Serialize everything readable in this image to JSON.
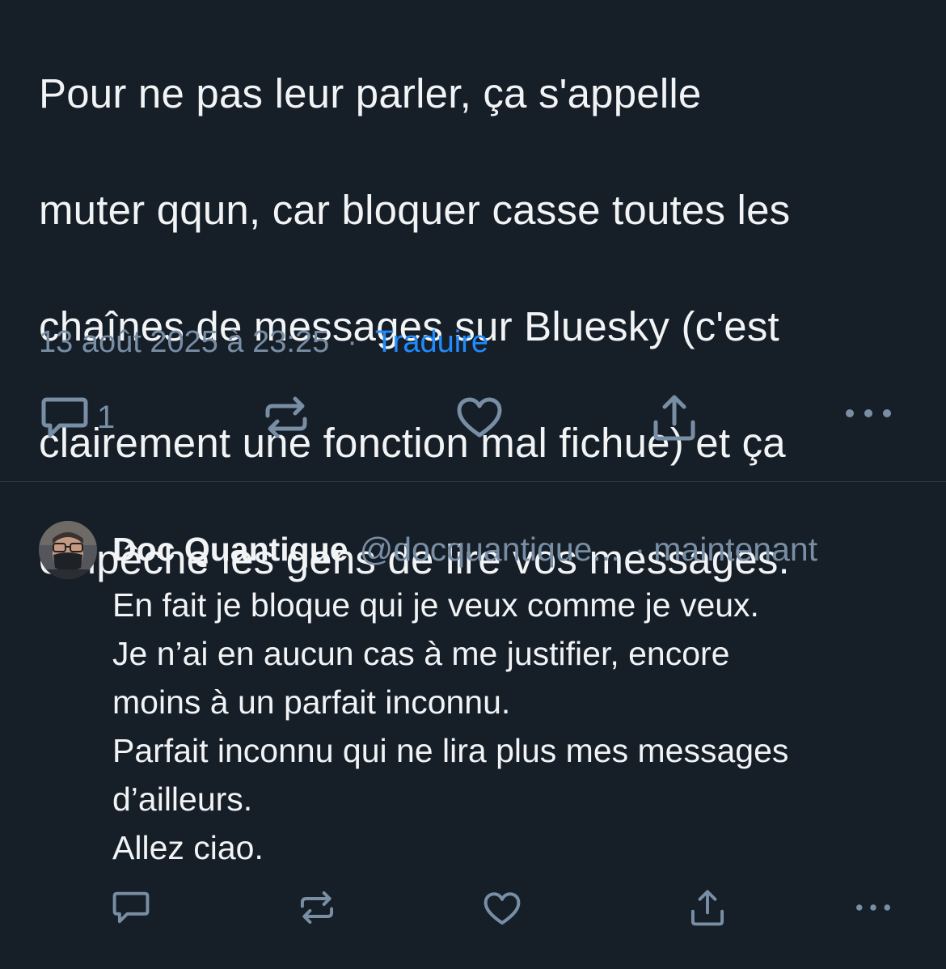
{
  "main_post": {
    "text_lines": [
      "Pour ne pas leur parler, ça s'appelle",
      "muter qqun, car bloquer casse toutes les",
      "chaînes de messages sur Bluesky (c'est",
      "clairement une fonction mal fichue) et ça",
      "empêche les gens de lire vos messages."
    ],
    "timestamp": "13 août 2025 à 23:25",
    "separator": "·",
    "translate_label": "Traduire",
    "reply_count": "1"
  },
  "reply": {
    "author_name": "Doc Quantique",
    "handle": "@docquantique...",
    "separator": "·",
    "time": "maintenant",
    "text_lines": [
      "En fait je bloque qui je veux comme je veux.",
      "Je n’ai en aucun cas à me justifier, encore",
      "moins à un parfait inconnu.",
      "Parfait inconnu qui ne lira plus mes messages",
      "d’ailleurs.",
      "Allez ciao."
    ]
  },
  "icons": {
    "reply": "speech-bubble-icon",
    "repost": "repost-arrows-icon",
    "like": "heart-icon",
    "share": "share-upload-icon",
    "more": "ellipsis-icon"
  },
  "colors": {
    "background": "#161e27",
    "text": "#f1f3f5",
    "muted": "#788ea5",
    "link": "#208bfe",
    "divider": "#2e3a48"
  }
}
